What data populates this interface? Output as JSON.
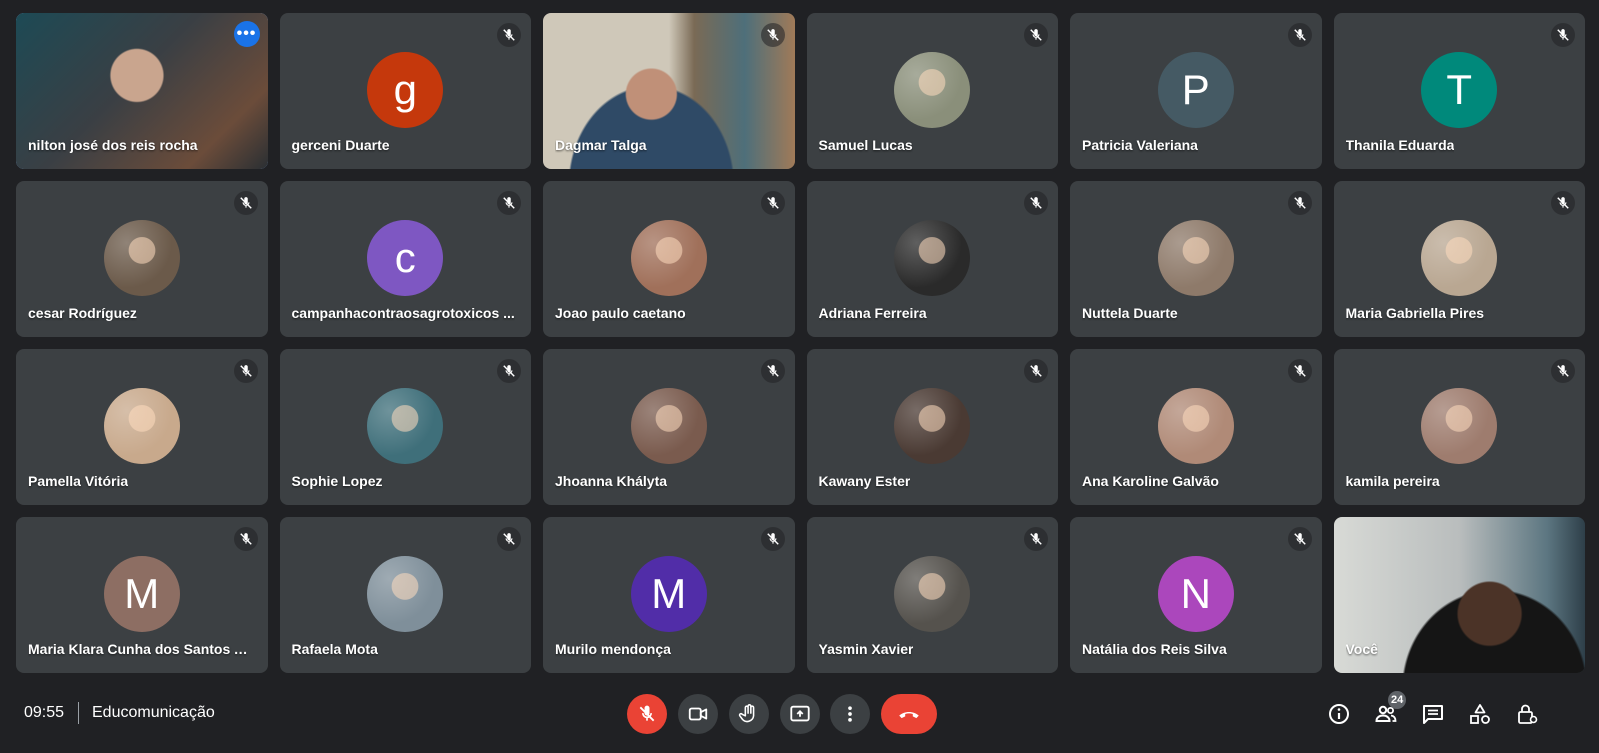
{
  "participants": [
    {
      "name": "nilton josé dos reis rocha",
      "kind": "video",
      "active": true
    },
    {
      "name": "gerceni Duarte",
      "kind": "letter",
      "letter": "g",
      "color": "#c5380c"
    },
    {
      "name": "Dagmar Talga",
      "kind": "video"
    },
    {
      "name": "Samuel Lucas",
      "kind": "photo",
      "color": "#8a8f7a"
    },
    {
      "name": "Patricia Valeriana",
      "kind": "letter",
      "letter": "P",
      "color": "#455a64"
    },
    {
      "name": "Thanila Eduarda",
      "kind": "letter",
      "letter": "T",
      "color": "#00897b"
    },
    {
      "name": "cesar Rodríguez",
      "kind": "photo",
      "color": "#6b5a4a"
    },
    {
      "name": "campanhacontraosagrotoxicos ...",
      "kind": "letter",
      "letter": "c",
      "color": "#7e57c2"
    },
    {
      "name": "Joao paulo caetano",
      "kind": "photo",
      "color": "#a0705a"
    },
    {
      "name": "Adriana Ferreira",
      "kind": "photo",
      "color": "#2a2a2a"
    },
    {
      "name": "Nuttela Duarte",
      "kind": "photo",
      "color": "#8e7a6a"
    },
    {
      "name": "Maria Gabriella Pires",
      "kind": "photo",
      "color": "#b9a792"
    },
    {
      "name": "Pamella Vitória",
      "kind": "photo",
      "color": "#c8a98c"
    },
    {
      "name": "Sophie Lopez",
      "kind": "photo",
      "color": "#3f6f7a"
    },
    {
      "name": "Jhoanna Khályta",
      "kind": "photo",
      "color": "#7a5b4e"
    },
    {
      "name": "Kawany Ester",
      "kind": "photo",
      "color": "#4a3a33"
    },
    {
      "name": "Ana Karoline Galvão",
      "kind": "photo",
      "color": "#b08a77"
    },
    {
      "name": "kamila pereira",
      "kind": "photo",
      "color": "#9e7c6e"
    },
    {
      "name": "Maria Klara Cunha dos Santos Ar...",
      "kind": "letter",
      "letter": "M",
      "color": "#8d6e63"
    },
    {
      "name": "Rafaela Mota",
      "kind": "photo",
      "color": "#7f8f9a"
    },
    {
      "name": "Murilo mendonça",
      "kind": "letter",
      "letter": "M",
      "color": "#512da8"
    },
    {
      "name": "Yasmin Xavier",
      "kind": "photo",
      "color": "#55524d"
    },
    {
      "name": "Natália dos Reis Silva",
      "kind": "letter",
      "letter": "N",
      "color": "#ab47bc"
    },
    {
      "name": "Você",
      "kind": "video-self"
    }
  ],
  "bottombar": {
    "clock": "09:55",
    "meeting_name": "Educomunicação",
    "participant_count": "24"
  },
  "colors": {
    "background": "#202124",
    "tile": "#3c4043",
    "active_border": "#8ab4f8",
    "end_call": "#ea4335"
  }
}
